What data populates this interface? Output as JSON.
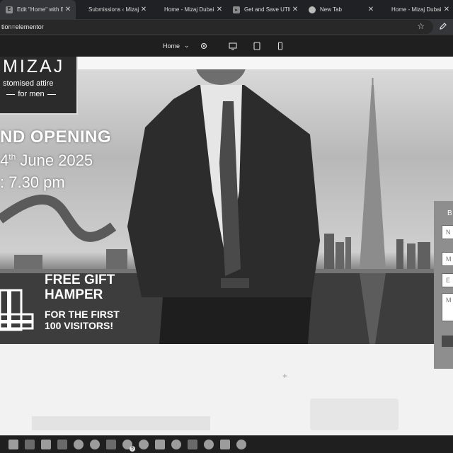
{
  "browser": {
    "tabs": [
      {
        "title": "Edit \"Home\" with Ele",
        "favicon": "elementor-icon",
        "active": true
      },
      {
        "title": "Submissions ‹ Mizaj",
        "favicon": "none",
        "active": false
      },
      {
        "title": "Home - Mizaj Dubai",
        "favicon": "none",
        "active": false
      },
      {
        "title": "Get and Save UTM Pa",
        "favicon": "bookmark-icon",
        "active": false
      },
      {
        "title": "New Tab",
        "favicon": "chrome-icon",
        "active": false
      },
      {
        "title": "Home - Mizaj Dubai",
        "favicon": "none",
        "active": false
      }
    ],
    "address": "tion=elementor"
  },
  "editor": {
    "page_label": "Home"
  },
  "hero": {
    "logo": {
      "name": "MIZAJ",
      "line1": "stomised attire",
      "line2": "for men"
    },
    "headline": "ND OPENING",
    "date_prefix": "4",
    "date_sup": "th",
    "date_rest": " June 2025",
    "time": ": 7.30 pm",
    "gift_title_1": "FREE GIFT",
    "gift_title_2": "HAMPER",
    "gift_sub_1": "FOR THE FIRST",
    "gift_sub_2": "100 VISITORS!"
  },
  "form": {
    "label": "B",
    "fields": [
      "N",
      "M",
      "E",
      "M"
    ]
  },
  "taskbar": {
    "items": [
      "file-explorer-icon",
      "filezilla-icon",
      "photos-icon",
      "folder-icon",
      "chrome-icon",
      "chrome-icon",
      "vscode-icon",
      "skype-icon",
      "chrome-icon",
      "notepad-icon",
      "browser-icon",
      "terminal-icon",
      "settings-icon",
      "mail-icon",
      "edge-icon"
    ],
    "badge": "5"
  },
  "colors": {
    "chrome_dark": "#202124",
    "tab_active": "#35363a",
    "editor_bar": "#1f1f1f"
  }
}
